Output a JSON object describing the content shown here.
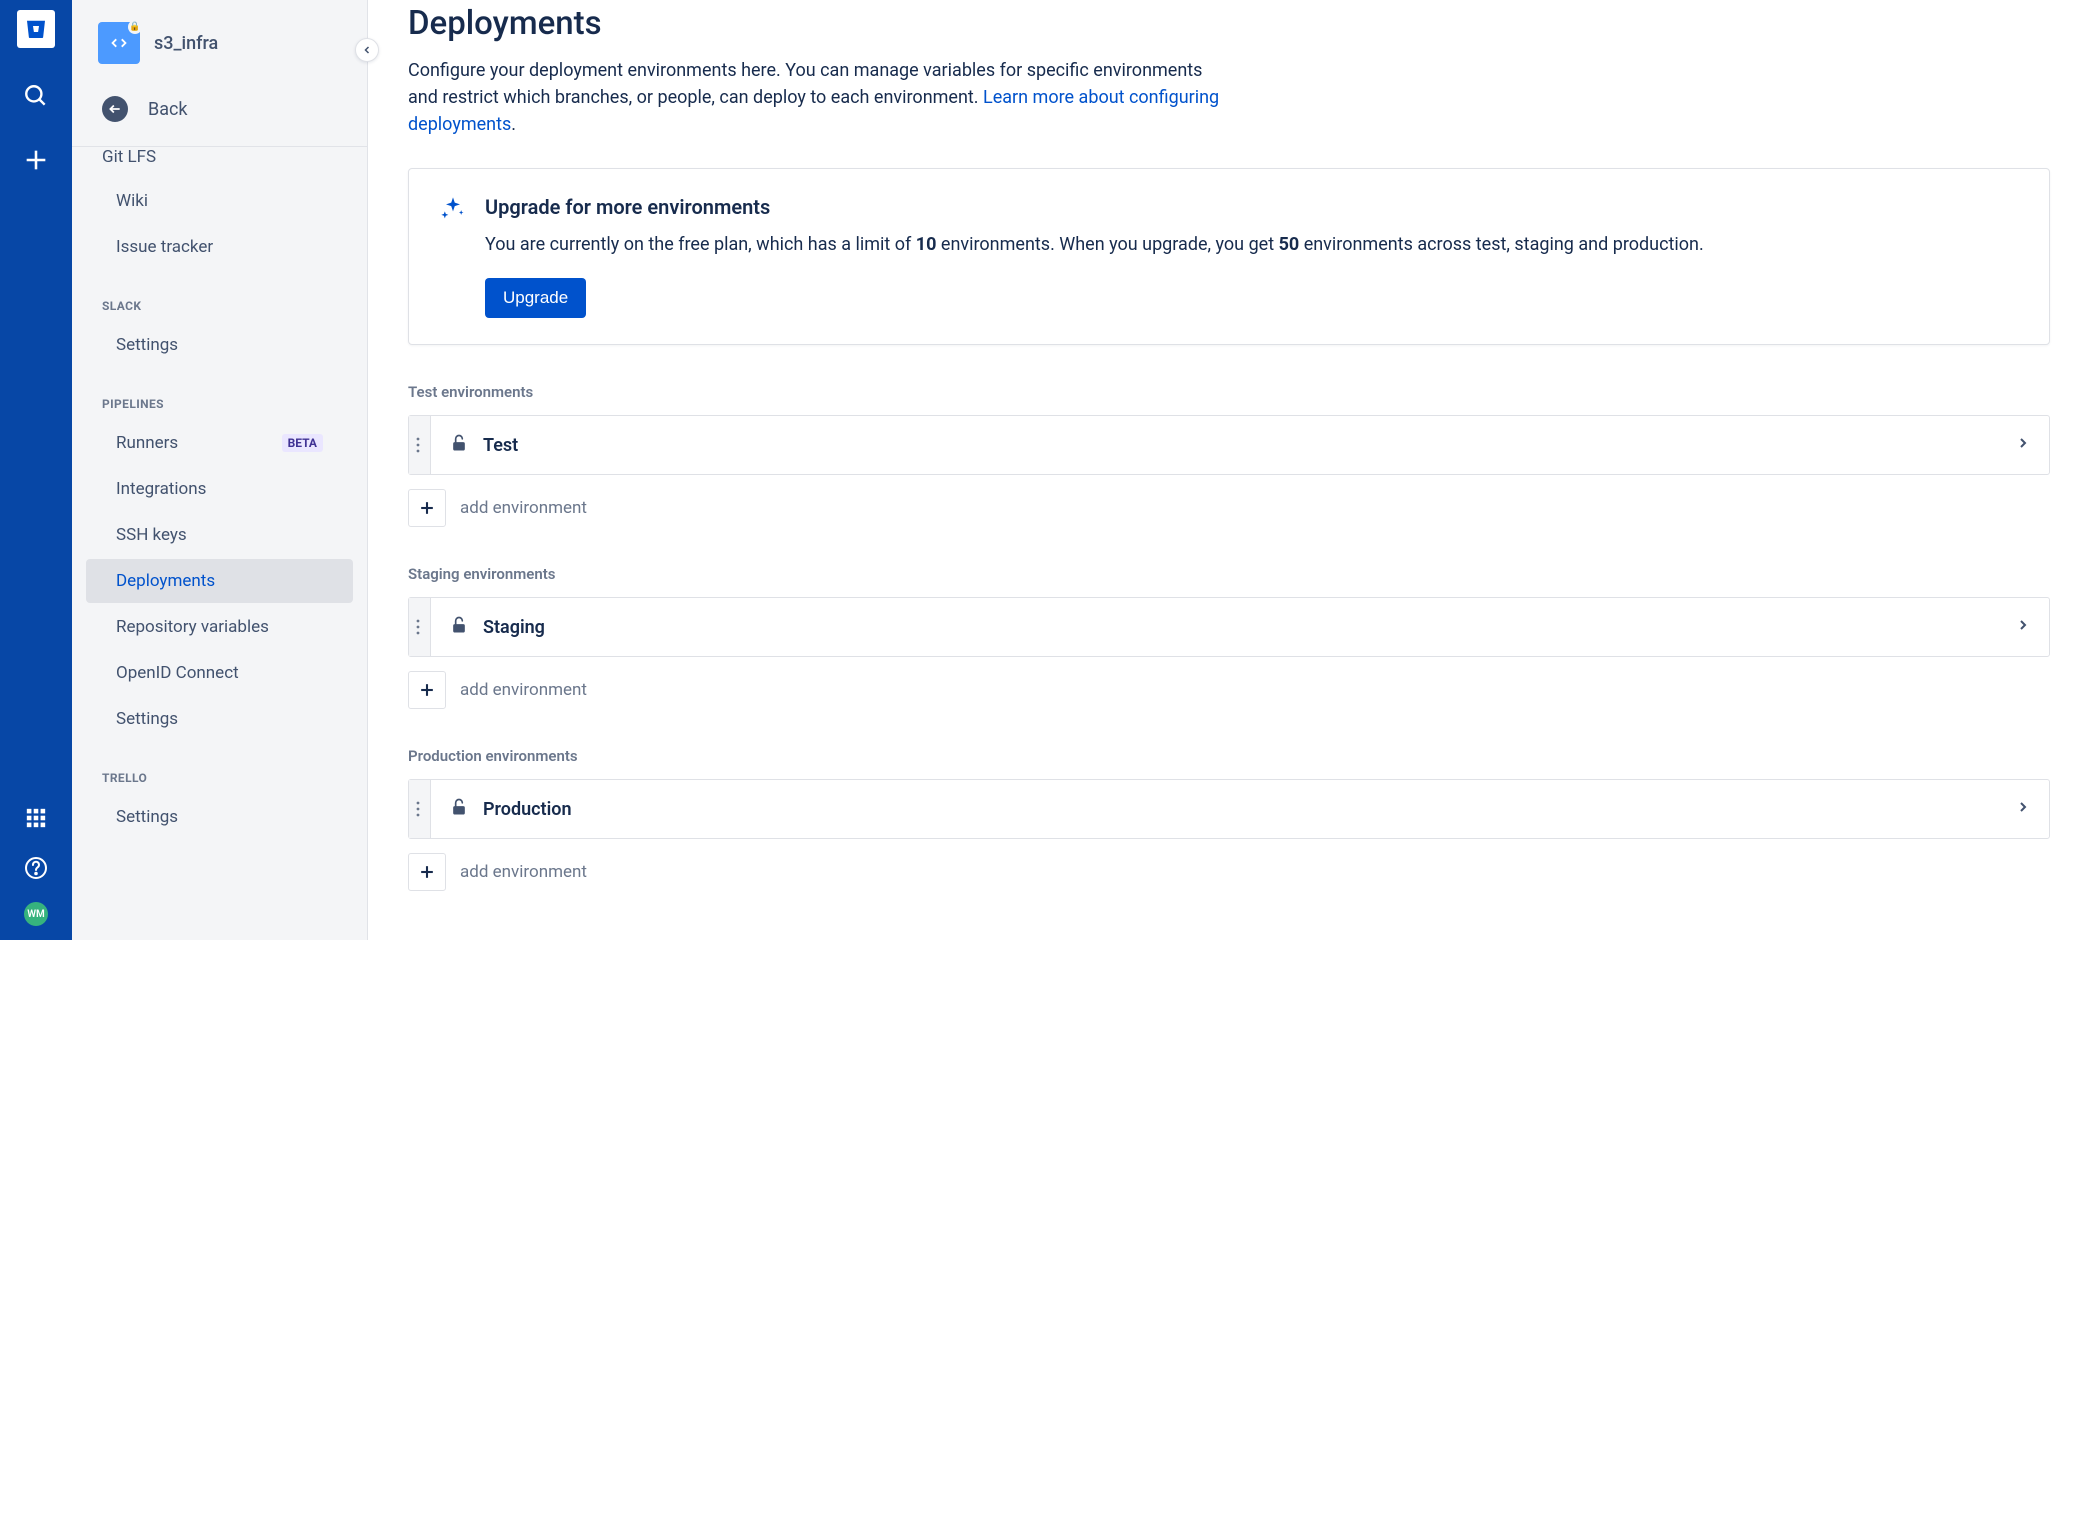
{
  "rail": {
    "avatar_initials": "WM"
  },
  "sidebar": {
    "repo_name": "s3_infra",
    "back_label": "Back",
    "partial_top_item": "Git LFS",
    "features": {
      "wiki": "Wiki",
      "issue_tracker": "Issue tracker"
    },
    "sections": {
      "slack": {
        "title": "SLACK",
        "settings": "Settings"
      },
      "pipelines": {
        "title": "PIPELINES",
        "runners": "Runners",
        "runners_badge": "BETA",
        "integrations": "Integrations",
        "ssh_keys": "SSH keys",
        "deployments": "Deployments",
        "repo_vars": "Repository variables",
        "openid": "OpenID Connect",
        "settings": "Settings"
      },
      "trello": {
        "title": "TRELLO",
        "settings": "Settings"
      }
    }
  },
  "main": {
    "title": "Deployments",
    "description": "Configure your deployment environments here. You can manage variables for specific environments and restrict which branches, or people, can deploy to each environment.",
    "learn_more": "Learn more about configuring deployments",
    "upgrade": {
      "title": "Upgrade for more environments",
      "text_pre": "You are currently on the free plan, which has a limit of ",
      "limit_free": "10",
      "text_mid": " environments. When you upgrade, you get ",
      "limit_paid": "50",
      "text_post": " environments across test, staging and production.",
      "button": "Upgrade"
    },
    "sections": [
      {
        "title": "Test environments",
        "env_name": "Test",
        "add_label": "add environment"
      },
      {
        "title": "Staging environments",
        "env_name": "Staging",
        "add_label": "add environment"
      },
      {
        "title": "Production environments",
        "env_name": "Production",
        "add_label": "add environment"
      }
    ]
  }
}
